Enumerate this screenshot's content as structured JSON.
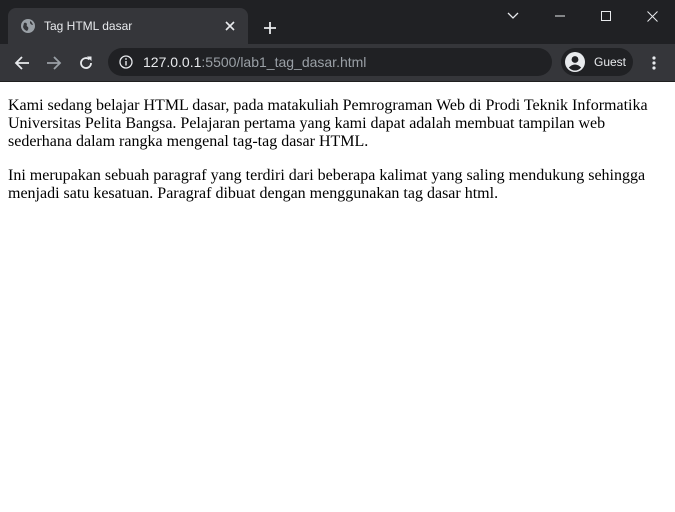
{
  "browser": {
    "tab": {
      "title": "Tag HTML dasar",
      "favicon": "globe-icon"
    },
    "address": {
      "host": "127.0.0.1",
      "rest": ":5500/lab1_tag_dasar.html"
    },
    "profile": {
      "label": "Guest"
    },
    "colors": {
      "frame": "#202124",
      "toolbar": "#35363a",
      "text": "#e8eaed",
      "muted": "#9aa0a6"
    }
  },
  "page": {
    "paragraphs": [
      "Kami sedang belajar HTML dasar, pada matakuliah Pemrograman Web di Prodi Teknik Informatika Universitas Pelita Bangsa. Pelajaran pertama yang kami dapat adalah membuat tampilan web sederhana dalam rangka mengenal tag-tag dasar HTML.",
      "Ini merupakan sebuah paragraf yang terdiri dari beberapa kalimat yang saling mendukung sehingga menjadi satu kesatuan. Paragraf dibuat dengan menggunakan tag dasar html."
    ]
  }
}
